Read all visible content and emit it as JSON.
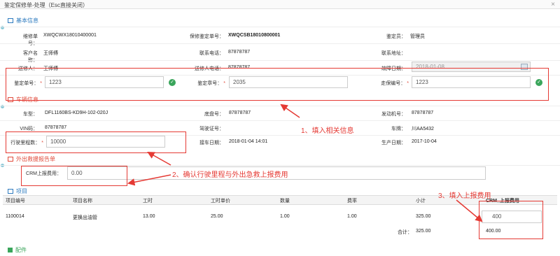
{
  "window": {
    "title": "鉴定保修单-处理（Esc直接关闭）",
    "close": "×"
  },
  "sections": {
    "basic": "基本信息",
    "vehicle": "车辆信息",
    "rescue": "外出救援报告单",
    "project": "项目",
    "parts": "配件"
  },
  "basic": {
    "repair_no_label": "维修单号：",
    "repair_no": "XWQCWX18010400001",
    "warranty_no_label": "保修鉴定单号：",
    "warranty_no": "XWQCSB18010800001",
    "appraiser_label": "鉴定员：",
    "appraiser": "管理员",
    "customer_label": "客户名称：",
    "customer": "王师傅",
    "phone_label": "联系电话：",
    "phone": "87878787",
    "address_label": "联系地址：",
    "address": "",
    "sender_label": "送修人：",
    "sender": "王师傅",
    "sender_phone_label": "送修人电话：",
    "sender_phone": "87878787",
    "fault_date_label": "故障日期：",
    "fault_date": "2018-01-08",
    "appraisal_no_label": "鉴定单号：",
    "appraisal_no": "1223",
    "appraisal_seal_label": "鉴定章号：",
    "appraisal_seal": "2035",
    "walk_no_label": "走保编号：",
    "walk_no": "1223"
  },
  "vehicle": {
    "model_label": "车型：",
    "model": "DFL1160BS-KD9H-102-020J",
    "chassis_label": "底盘号：",
    "chassis": "87878787",
    "engine_label": "发动机号：",
    "engine": "87878787",
    "vin_label": "VIN码：",
    "vin": "87878787",
    "license_label": "驾驶证号：",
    "license": "",
    "plate_label": "车牌：",
    "plate": "川AA5432",
    "mileage_label": "行驶里程数：",
    "mileage": "10000",
    "pickup_label": "接车日期：",
    "pickup": "2018-01-04 14:01",
    "production_label": "生产日期：",
    "production": "2017-10-04"
  },
  "rescue": {
    "crm_label": "CRM上报费用：",
    "crm_value": "0.00"
  },
  "project": {
    "columns": [
      "项目编号",
      "项目名称",
      "工时",
      "工时单价",
      "数量",
      "费率",
      "小计",
      "CRM_上报费用"
    ],
    "rows": [
      [
        "1100014",
        "更换出油管",
        "13.00",
        "25.00",
        "1.00",
        "1.00",
        "325.00",
        "400"
      ]
    ],
    "total_label": "合计：",
    "total_subtotal": "325.00",
    "total_crm": "400.00"
  },
  "annotations": {
    "n1": "1、填入相关信息",
    "n2": "2、确认行驶里程与外出急救上报费用",
    "n3": "3、填入上报费用"
  },
  "colors": {
    "accent": "#2e7bbf",
    "annotation": "#e53a34",
    "ok": "#3aa55b"
  }
}
